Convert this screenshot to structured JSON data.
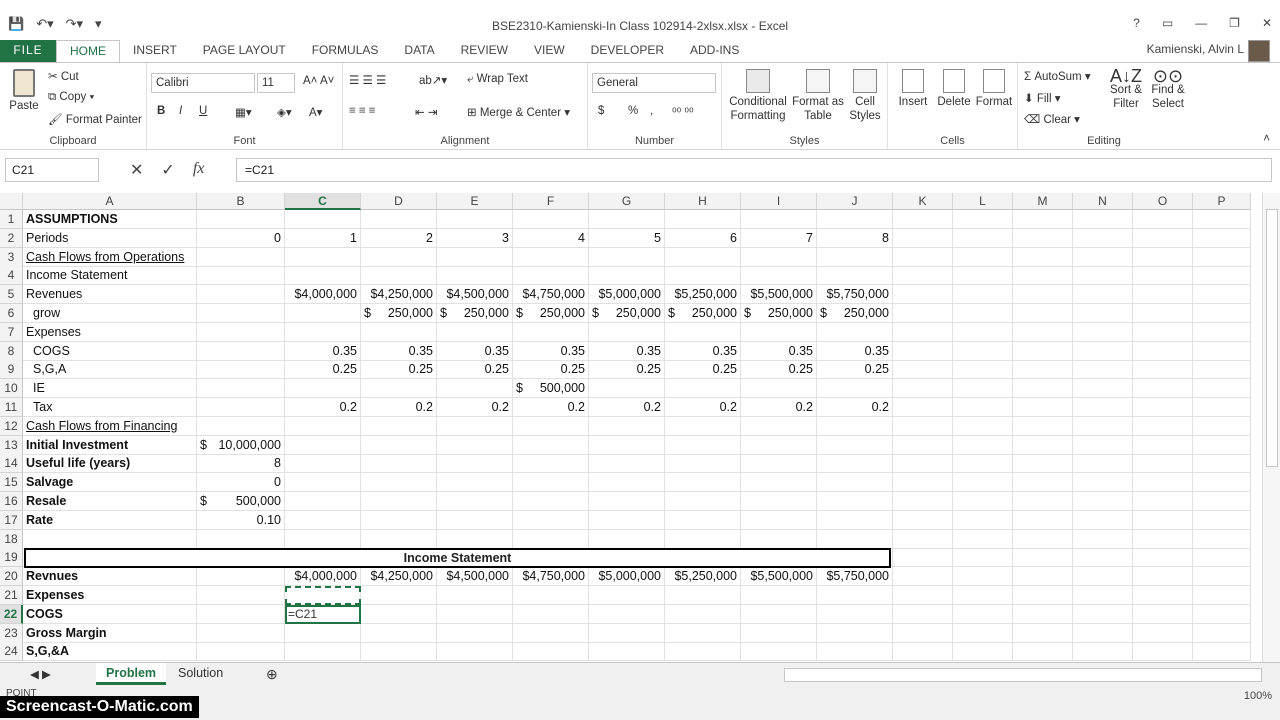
{
  "window": {
    "title": "BSE2310-Kamienski-In Class 102914-2xlsx.xlsx - Excel",
    "user": "Kamienski, Alvin L",
    "controls": [
      "?",
      "▭",
      "—",
      "❐",
      "✕"
    ]
  },
  "tabs": [
    "FILE",
    "HOME",
    "INSERT",
    "PAGE LAYOUT",
    "FORMULAS",
    "DATA",
    "REVIEW",
    "VIEW",
    "DEVELOPER",
    "ADD-INS"
  ],
  "active_tab": "HOME",
  "ribbon": {
    "clipboard": {
      "paste": "Paste",
      "cut": "Cut",
      "copy": "Copy",
      "format_painter": "Format Painter",
      "label": "Clipboard"
    },
    "font": {
      "name": "Calibri",
      "size": "11",
      "bold": "B",
      "italic": "I",
      "underline": "U",
      "label": "Font"
    },
    "alignment": {
      "wrap": "Wrap Text",
      "merge": "Merge & Center",
      "label": "Alignment"
    },
    "number": {
      "format": "General",
      "currency": "$",
      "percent": "%",
      "comma": ",",
      "label": "Number"
    },
    "styles": {
      "conditional": "Conditional Formatting",
      "format_table": "Format as Table",
      "cell_styles": "Cell Styles",
      "label": "Styles"
    },
    "cells": {
      "insert": "Insert",
      "delete": "Delete",
      "format": "Format",
      "label": "Cells"
    },
    "editing": {
      "autosum": "AutoSum",
      "fill": "Fill",
      "clear": "Clear",
      "sort": "Sort & Filter",
      "find": "Find & Select",
      "label": "Editing"
    }
  },
  "formula_bar": {
    "name_box": "C21",
    "formula": "=C21"
  },
  "columns": [
    "A",
    "B",
    "C",
    "D",
    "E",
    "F",
    "G",
    "H",
    "I",
    "J",
    "K",
    "L",
    "M",
    "N",
    "O",
    "P"
  ],
  "selected_column": "C",
  "rows": [
    "1",
    "2",
    "3",
    "4",
    "5",
    "6",
    "7",
    "8",
    "9",
    "10",
    "11",
    "12",
    "13",
    "14",
    "15",
    "16",
    "17",
    "18",
    "19",
    "20",
    "21",
    "22",
    "23",
    "24"
  ],
  "selected_row": "22",
  "cells": {
    "A1": "ASSUMPTIONS",
    "A2": "Periods",
    "B2": "0",
    "C2": "1",
    "D2": "2",
    "E2": "3",
    "F2": "4",
    "G2": "5",
    "H2": "6",
    "I2": "7",
    "J2": "8",
    "A3": "Cash Flows from Operations",
    "A4": "Income Statement",
    "A5": "Revenues",
    "C5": "$4,000,000",
    "D5": "$4,250,000",
    "E5": "$4,500,000",
    "F5": "$4,750,000",
    "G5": "$5,000,000",
    "H5": "$5,250,000",
    "I5": "$5,500,000",
    "J5": "$5,750,000",
    "A6": "grow",
    "D6": "250,000",
    "E6": "250,000",
    "F6": "250,000",
    "G6": "250,000",
    "H6": "250,000",
    "I6": "250,000",
    "J6": "250,000",
    "A7": "Expenses",
    "A8": "COGS",
    "C8": "0.35",
    "D8": "0.35",
    "E8": "0.35",
    "F8": "0.35",
    "G8": "0.35",
    "H8": "0.35",
    "I8": "0.35",
    "J8": "0.35",
    "A9": "S,G,A",
    "C9": "0.25",
    "D9": "0.25",
    "E9": "0.25",
    "F9": "0.25",
    "G9": "0.25",
    "H9": "0.25",
    "I9": "0.25",
    "J9": "0.25",
    "A10": "IE",
    "F10": "500,000",
    "A11": "Tax",
    "C11": "0.2",
    "D11": "0.2",
    "E11": "0.2",
    "F11": "0.2",
    "G11": "0.2",
    "H11": "0.2",
    "I11": "0.2",
    "J11": "0.2",
    "A12": "Cash Flows from Financing",
    "A13": "Initial Investment",
    "B13": "10,000,000",
    "A14": "Useful life (years)",
    "B14": "8",
    "A15": "Salvage",
    "B15": "0",
    "A16": "Resale",
    "B16": "500,000",
    "A17": "Rate",
    "B17": "0.10",
    "A19_banner": "Income Statement",
    "A20": "Revnues",
    "C20": "$4,000,000",
    "D20": "$4,250,000",
    "E20": "$4,500,000",
    "F20": "$4,750,000",
    "G20": "$5,000,000",
    "H20": "$5,250,000",
    "I20": "$5,500,000",
    "J20": "$5,750,000",
    "A21": "Expenses",
    "A22": "COGS",
    "C22": "=C21",
    "A23": "Gross Margin",
    "A24": "S,G,&A"
  },
  "currency_symbol": "$",
  "sheets": [
    "Problem",
    "Solution"
  ],
  "active_sheet": "Problem",
  "status": {
    "mode": "POINT",
    "zoom": "100%"
  },
  "watermark": "Screencast-O-Matic.com",
  "colors": {
    "accent": "#217346"
  }
}
